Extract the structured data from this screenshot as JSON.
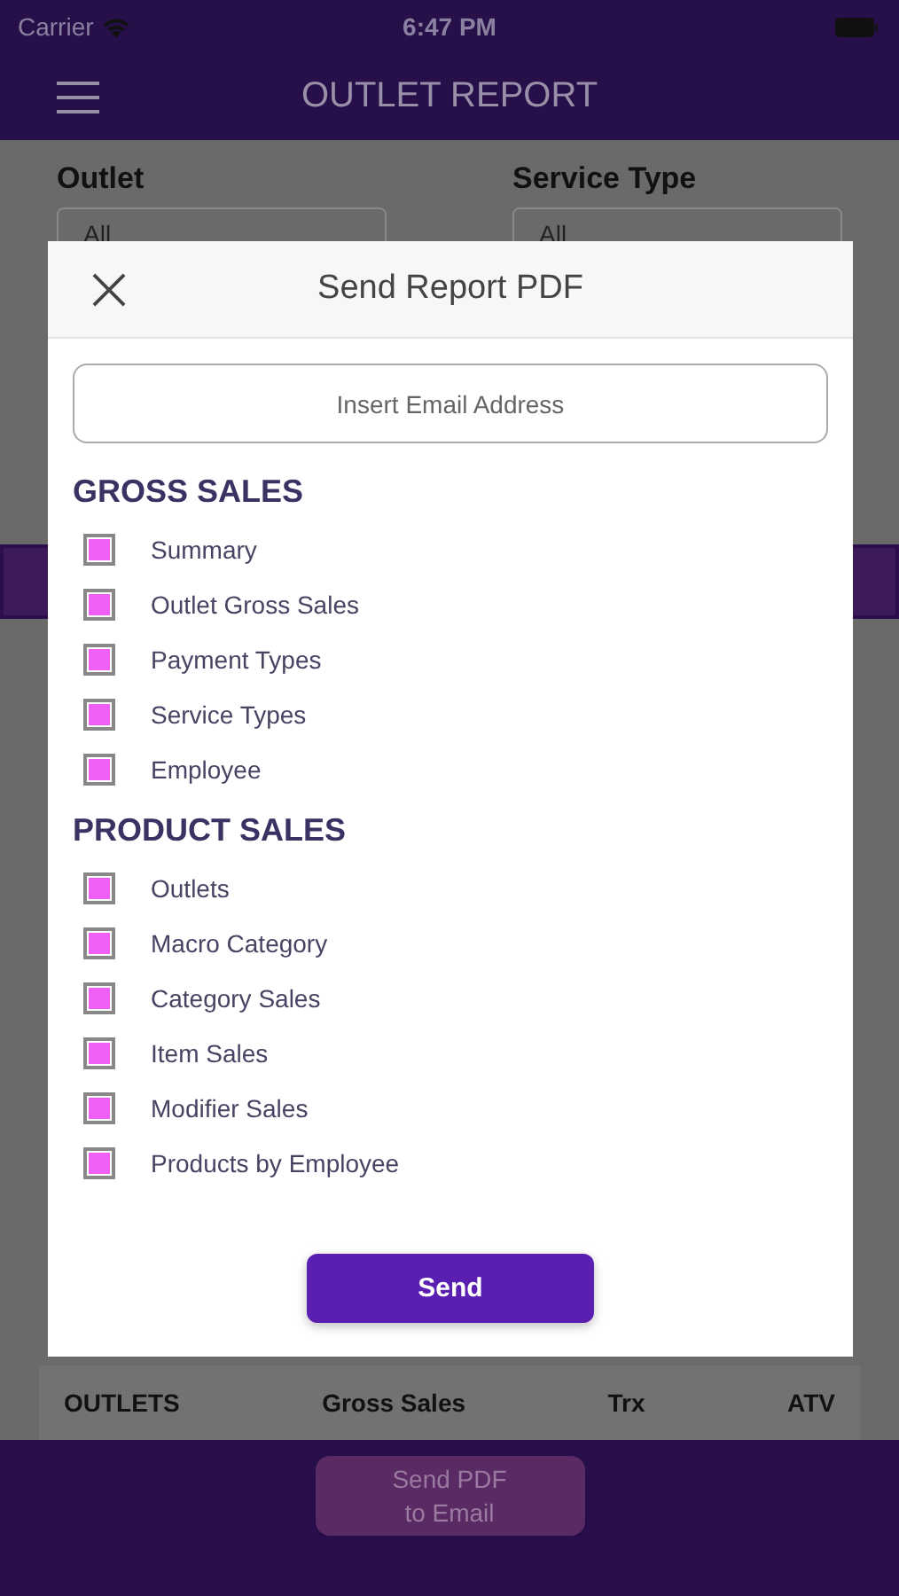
{
  "status_bar": {
    "carrier": "Carrier",
    "time": "6:47 PM"
  },
  "nav": {
    "title": "OUTLET REPORT"
  },
  "filters": [
    {
      "label": "Outlet",
      "value": "All"
    },
    {
      "label": "Service Type",
      "value": "All"
    }
  ],
  "table": {
    "columns": [
      "OUTLETS",
      "Gross Sales",
      "Trx",
      "ATV"
    ]
  },
  "footer_button": {
    "label": "Send PDF to Email"
  },
  "modal": {
    "title": "Send Report PDF",
    "email": {
      "placeholder": "Insert Email Address"
    },
    "sections": [
      {
        "title": "GROSS SALES",
        "items": [
          {
            "label": "Summary",
            "checked": true
          },
          {
            "label": "Outlet Gross Sales",
            "checked": true
          },
          {
            "label": "Payment Types",
            "checked": true
          },
          {
            "label": "Service Types",
            "checked": true
          },
          {
            "label": "Employee",
            "checked": true
          }
        ]
      },
      {
        "title": "PRODUCT SALES",
        "items": [
          {
            "label": "Outlets",
            "checked": true
          },
          {
            "label": "Macro Category",
            "checked": true
          },
          {
            "label": "Category Sales",
            "checked": true
          },
          {
            "label": "Item Sales",
            "checked": true
          },
          {
            "label": "Modifier Sales",
            "checked": true
          },
          {
            "label": "Products by Employee",
            "checked": true
          }
        ]
      }
    ],
    "send_button": "Send"
  }
}
